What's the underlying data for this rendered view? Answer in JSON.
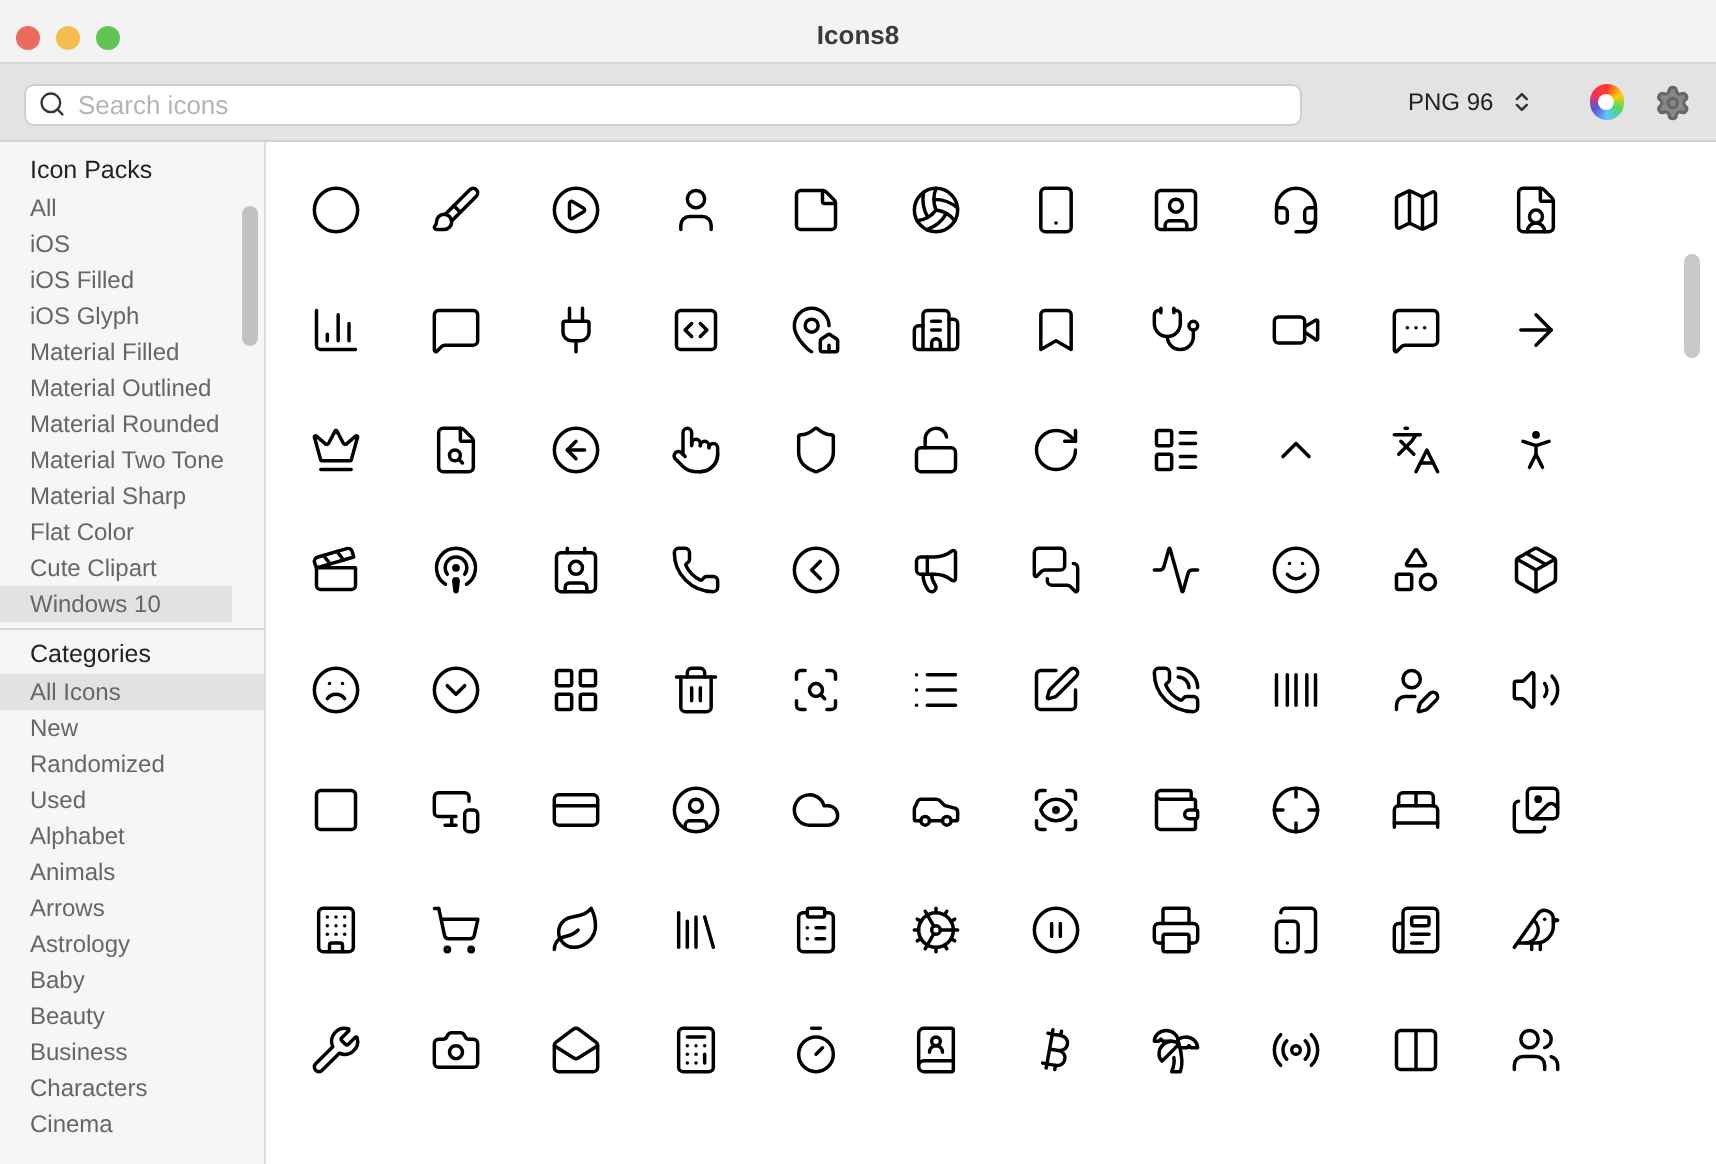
{
  "window": {
    "title": "Icons8"
  },
  "search": {
    "placeholder": "Search icons"
  },
  "format": {
    "label": "PNG 96"
  },
  "icon_packs": {
    "heading": "Icon Packs",
    "items": [
      {
        "label": "All",
        "selected": false
      },
      {
        "label": "iOS",
        "selected": false
      },
      {
        "label": "iOS Filled",
        "selected": false
      },
      {
        "label": "iOS Glyph",
        "selected": false
      },
      {
        "label": "Material Filled",
        "selected": false
      },
      {
        "label": "Material Outlined",
        "selected": false
      },
      {
        "label": "Material Rounded",
        "selected": false
      },
      {
        "label": "Material Two Tone",
        "selected": false
      },
      {
        "label": "Material Sharp",
        "selected": false
      },
      {
        "label": "Flat Color",
        "selected": false
      },
      {
        "label": "Cute Clipart",
        "selected": false
      },
      {
        "label": "Windows 10",
        "selected": true
      }
    ]
  },
  "categories": {
    "heading": "Categories",
    "items": [
      {
        "label": "All Icons",
        "selected": true
      },
      {
        "label": "New",
        "selected": false
      },
      {
        "label": "Randomized",
        "selected": false
      },
      {
        "label": "Used",
        "selected": false
      },
      {
        "label": "Alphabet",
        "selected": false
      },
      {
        "label": "Animals",
        "selected": false
      },
      {
        "label": "Arrows",
        "selected": false
      },
      {
        "label": "Astrology",
        "selected": false
      },
      {
        "label": "Baby",
        "selected": false
      },
      {
        "label": "Beauty",
        "selected": false
      },
      {
        "label": "Business",
        "selected": false
      },
      {
        "label": "Characters",
        "selected": false
      },
      {
        "label": "Cinema",
        "selected": false
      }
    ]
  }
}
